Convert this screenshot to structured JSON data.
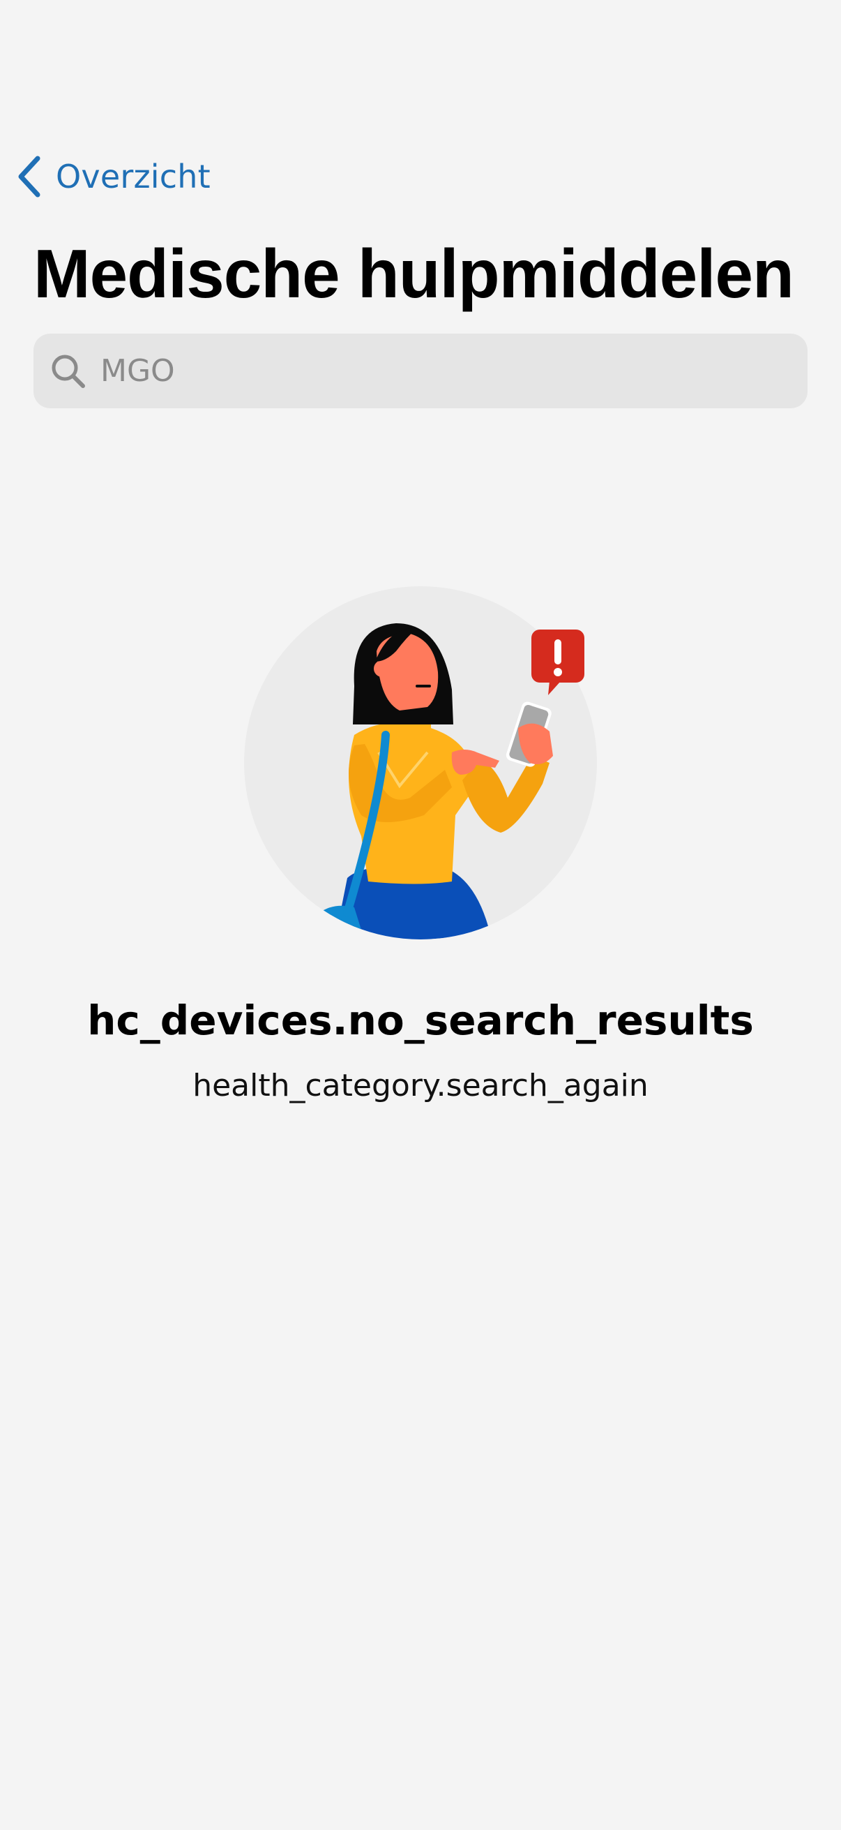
{
  "nav": {
    "back_label": "Overzicht"
  },
  "header": {
    "title": "Medische hulpmiddelen"
  },
  "search": {
    "value": "",
    "placeholder": "MGO"
  },
  "empty_state": {
    "title": "hc_devices.no_search_results",
    "subtitle": "health_category.search_again"
  },
  "colors": {
    "accent": "#1f6fb5",
    "background": "#f4f4f4",
    "search_bg": "#e5e5e5",
    "alert": "#d52b1e"
  },
  "icons": {
    "back": "chevron-left-icon",
    "search": "search-icon",
    "illustration": "woman-with-phone-alert-illustration"
  }
}
